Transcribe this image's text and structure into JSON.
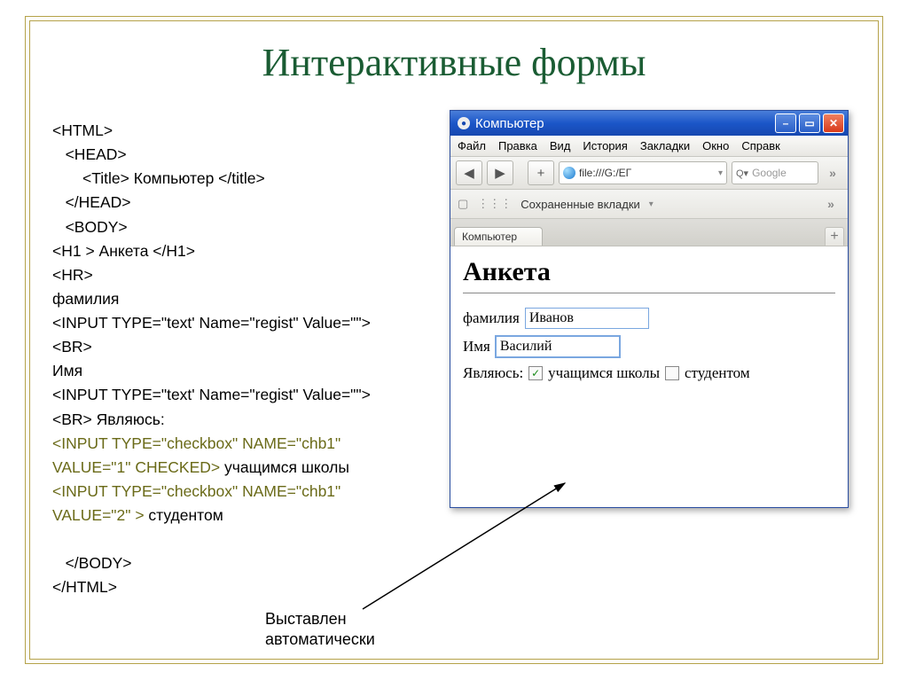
{
  "slide": {
    "title": "Интерактивные формы"
  },
  "code": {
    "l1": "<HTML>",
    "l2": "   <HEAD>",
    "l3": "       <Title> Компьютер </title>",
    "l4": "   </HEAD>",
    "l5": "   <BODY>",
    "l6": "<H1 > Анкета </H1>",
    "l7": "<HR>",
    "l8": "фамилия",
    "l9": "<INPUT TYPE=\"text' Name=\"regist\" Value=\"\">",
    "l10": "<BR>",
    "l11": "Имя",
    "l12": "<INPUT TYPE=\"text' Name=\"regist\" Value=\"\">",
    "l13": "<BR> Являюсь:",
    "l14": "<INPUT TYPE=\"checkbox\" NAME=\"chb1\" ",
    "l15": "VALUE=\"1\" CHECKED>",
    "l15b": " учащимся школы",
    "l16": "<INPUT TYPE=\"checkbox\" NAME=\"chb1\" ",
    "l17": "VALUE=\"2\" >",
    "l17b": " студентом",
    "l18": "   </BODY>",
    "l19": "</HTML>"
  },
  "browser": {
    "window_title": "Компьютер",
    "menu": {
      "file": "Файл",
      "edit": "Правка",
      "view": "Вид",
      "history": "История",
      "bookmarks": "Закладки",
      "window": "Окно",
      "help": "Справк"
    },
    "url": "file:///G:/ЕГ",
    "search_placeholder": "Google",
    "saved_tabs": "Сохраненные вкладки",
    "tab": "Компьютер",
    "page_h1": "Анкета",
    "label_surname": "фамилия",
    "value_surname": "Иванов",
    "label_name": "Имя",
    "value_name": "Василий",
    "label_iam": "Являюсь:",
    "cb1_label": "учащимся школы",
    "cb2_label": "студентом"
  },
  "annotation": {
    "line1": "Выставлен",
    "line2": "автоматически"
  }
}
